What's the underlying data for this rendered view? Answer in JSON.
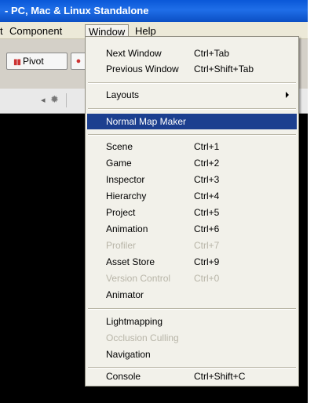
{
  "window": {
    "title": "- PC, Mac & Linux Standalone"
  },
  "menubar": {
    "items": [
      {
        "label": "t"
      },
      {
        "label": "Component"
      },
      {
        "label": "Window"
      },
      {
        "label": "Help"
      }
    ]
  },
  "toolbar": {
    "pivot_label": "Pivot"
  },
  "window_menu": {
    "next_window": {
      "label": "Next Window",
      "shortcut": "Ctrl+Tab"
    },
    "previous_window": {
      "label": "Previous Window",
      "shortcut": "Ctrl+Shift+Tab"
    },
    "layouts": {
      "label": "Layouts"
    },
    "normal_map_maker": {
      "label": "Normal Map Maker"
    },
    "scene": {
      "label": "Scene",
      "shortcut": "Ctrl+1"
    },
    "game": {
      "label": "Game",
      "shortcut": "Ctrl+2"
    },
    "inspector": {
      "label": "Inspector",
      "shortcut": "Ctrl+3"
    },
    "hierarchy": {
      "label": "Hierarchy",
      "shortcut": "Ctrl+4"
    },
    "project": {
      "label": "Project",
      "shortcut": "Ctrl+5"
    },
    "animation": {
      "label": "Animation",
      "shortcut": "Ctrl+6"
    },
    "profiler": {
      "label": "Profiler",
      "shortcut": "Ctrl+7"
    },
    "asset_store": {
      "label": "Asset Store",
      "shortcut": "Ctrl+9"
    },
    "version_control": {
      "label": "Version Control",
      "shortcut": "Ctrl+0"
    },
    "animator": {
      "label": "Animator"
    },
    "lightmapping": {
      "label": "Lightmapping"
    },
    "occlusion_culling": {
      "label": "Occlusion Culling"
    },
    "navigation": {
      "label": "Navigation"
    },
    "console": {
      "label": "Console",
      "shortcut": "Ctrl+Shift+C"
    }
  }
}
